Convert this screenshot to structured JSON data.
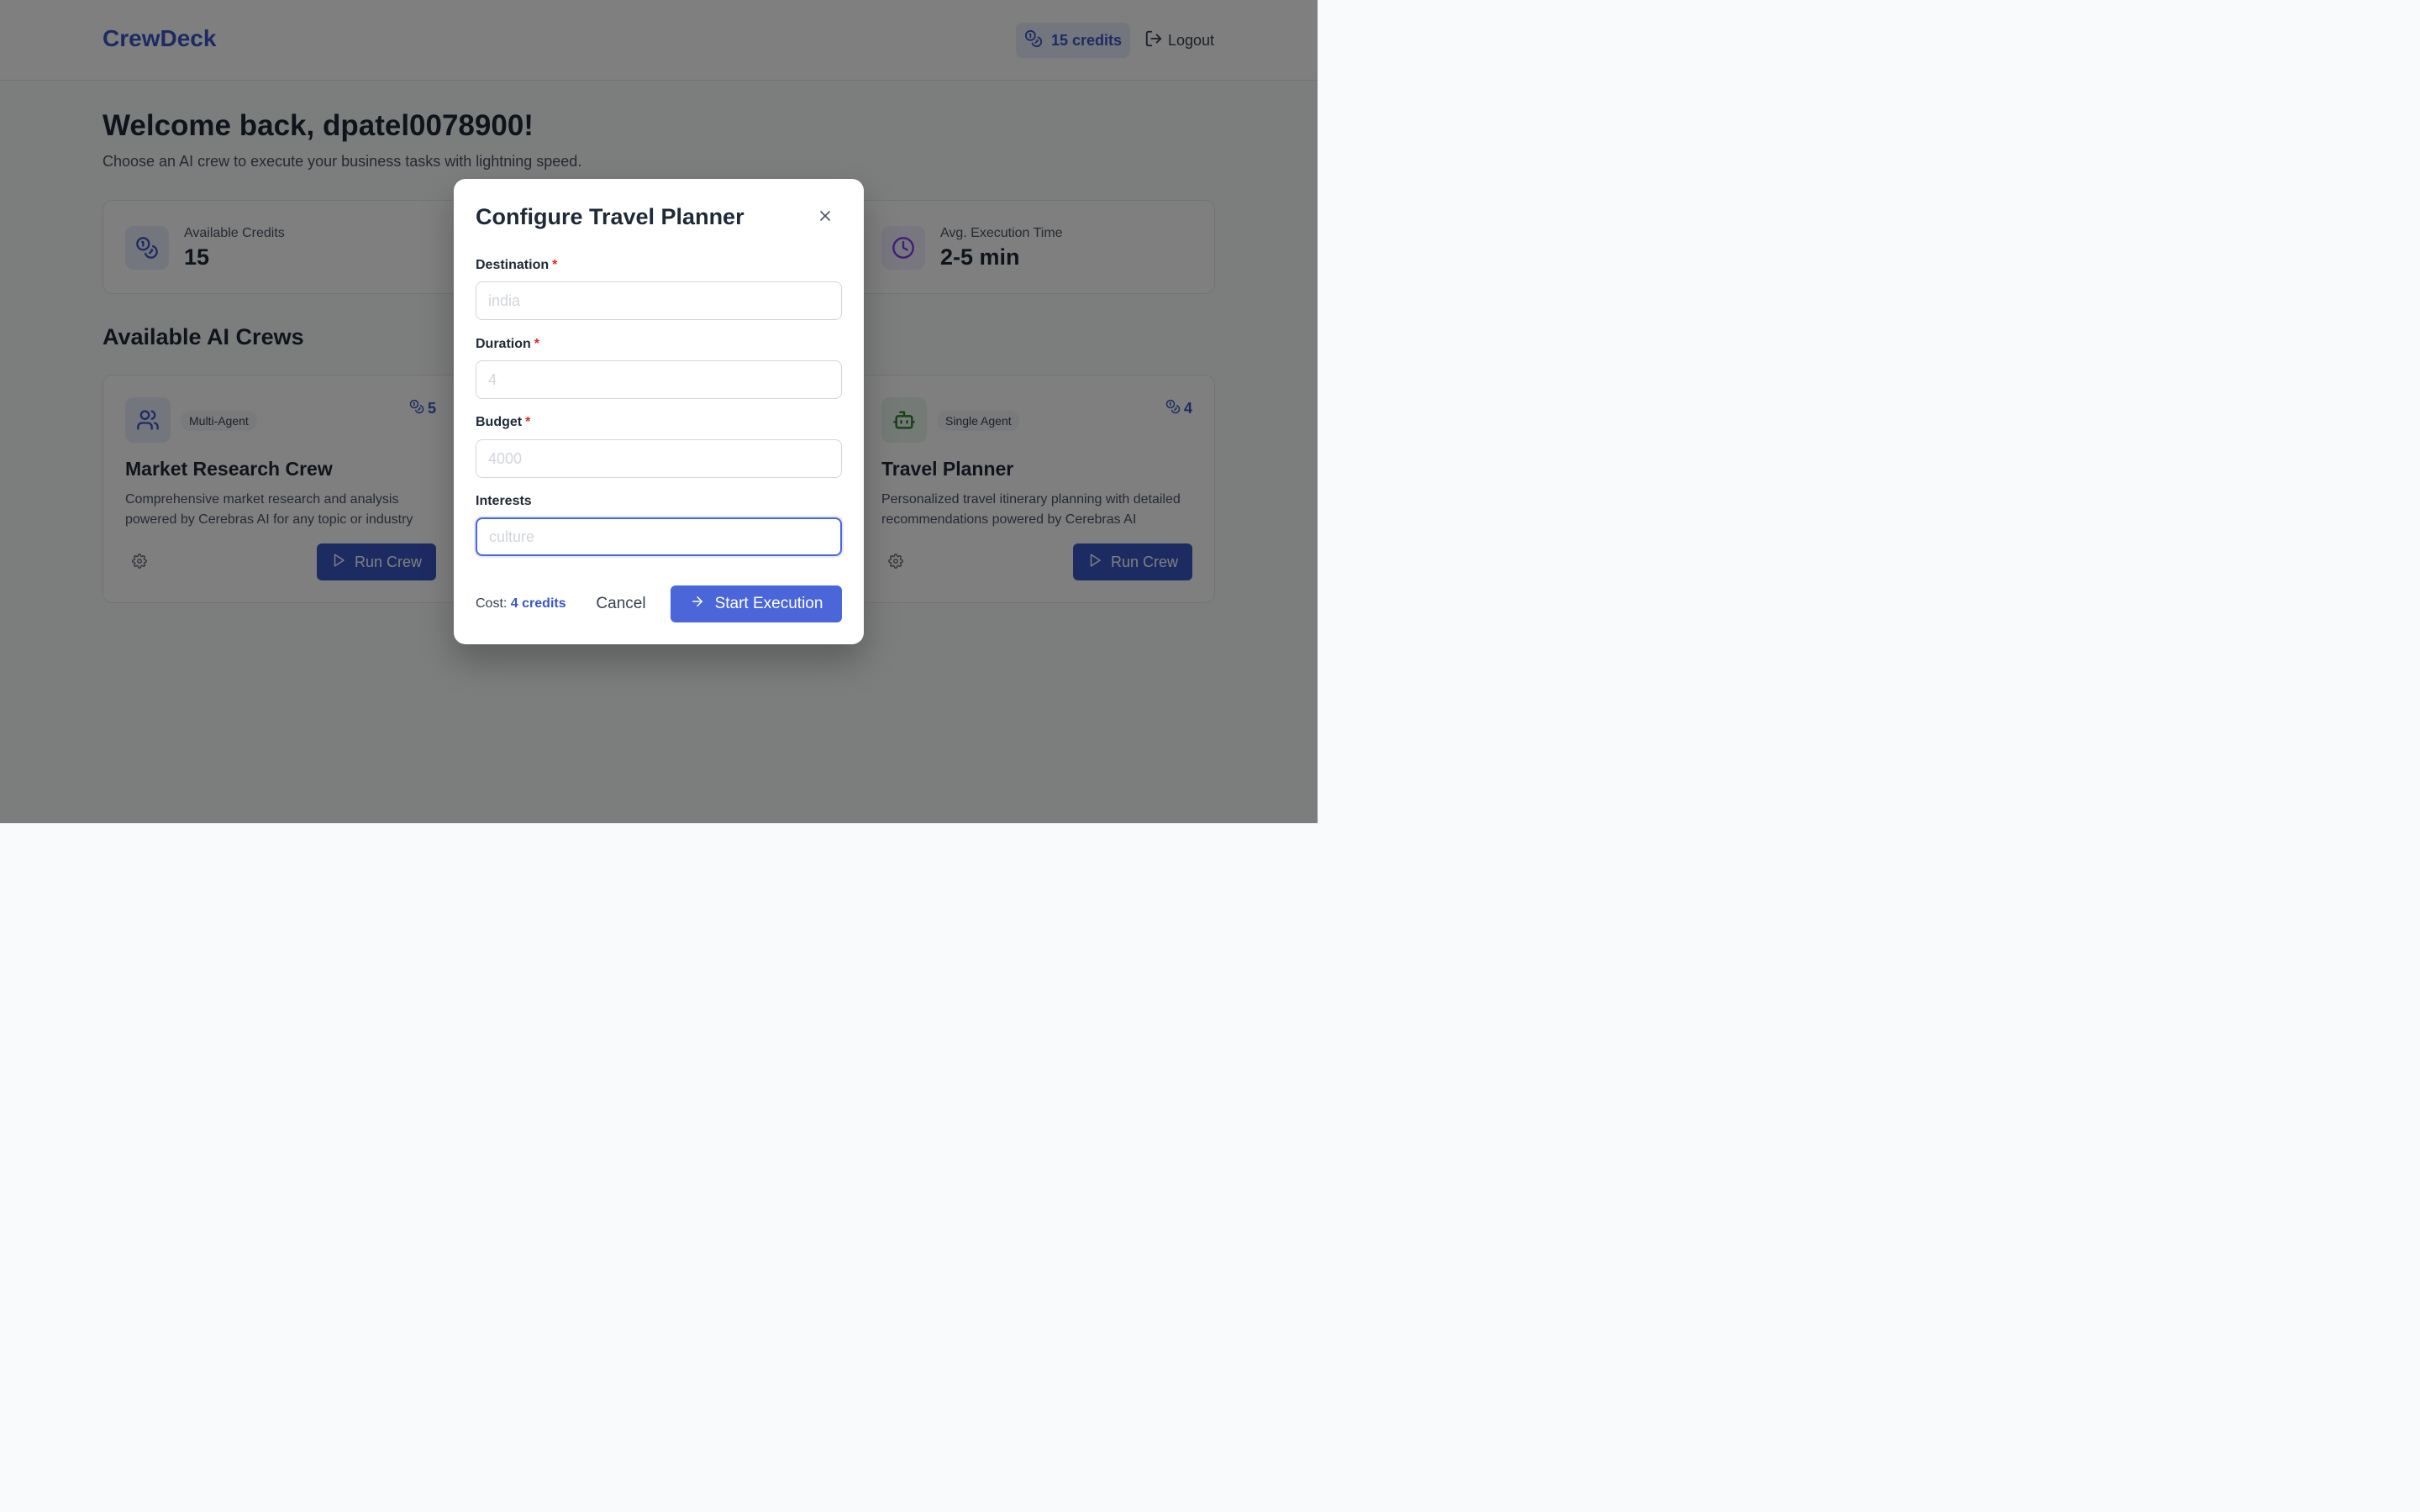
{
  "header": {
    "brand": "CrewDeck",
    "credits_label": "15 credits",
    "logout_label": "Logout"
  },
  "welcome": {
    "title": "Welcome back, dpatel0078900!",
    "subtitle": "Choose an AI crew to execute your business tasks with lightning speed."
  },
  "stats": [
    {
      "label": "Available Credits",
      "value": "15",
      "icon": "coins-icon",
      "color": "#3a56c7"
    },
    {
      "label": "Avg. Execution Time",
      "value": "2-5 min",
      "icon": "clock-icon",
      "color": "#7c3aed"
    }
  ],
  "crews_section_title": "Available AI Crews",
  "crews": [
    {
      "badge": "Multi-Agent",
      "cost": "5",
      "title": "Market Research Crew",
      "description": "Comprehensive market research and analysis powered by Cerebras AI for any topic or industry",
      "run_label": "Run Crew",
      "icon": "users-icon"
    },
    {
      "badge": "Single Agent",
      "cost": "4",
      "title": "Travel Planner",
      "description": "Personalized travel itinerary planning with detailed recommendations powered by Cerebras AI",
      "run_label": "Run Crew",
      "icon": "bot-icon"
    }
  ],
  "modal": {
    "title": "Configure Travel Planner",
    "fields": [
      {
        "label": "Destination",
        "required": "*",
        "value": "",
        "placeholder": "india"
      },
      {
        "label": "Duration",
        "required": "*",
        "value": "",
        "placeholder": "4"
      },
      {
        "label": "Budget",
        "required": "*",
        "value": "",
        "placeholder": "4000"
      },
      {
        "label": "Interests",
        "required": "",
        "value": "",
        "placeholder": "culture"
      }
    ],
    "cost_prefix": "Cost:",
    "cost_value": "4 credits",
    "cancel_label": "Cancel",
    "start_label": "Start Execution"
  },
  "colors": {
    "brand": "#3a56c7",
    "primary_button": "#4a66d9",
    "required": "#dc2626"
  }
}
